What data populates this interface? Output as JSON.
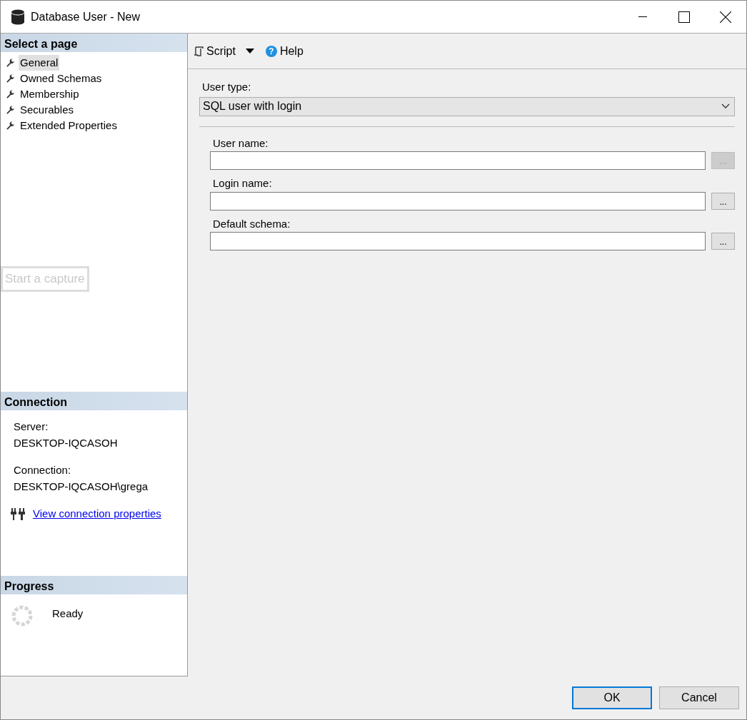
{
  "window": {
    "title": "Database User - New"
  },
  "select_page": {
    "title": "Select a page",
    "items": [
      {
        "label": "General",
        "selected": true
      },
      {
        "label": "Owned Schemas",
        "selected": false
      },
      {
        "label": "Membership",
        "selected": false
      },
      {
        "label": "Securables",
        "selected": false
      },
      {
        "label": "Extended Properties",
        "selected": false
      }
    ]
  },
  "capture_overlay": {
    "label": "Start a capture"
  },
  "connection": {
    "title": "Connection",
    "server_label": "Server:",
    "server": "DESKTOP-IQCASOH",
    "connection_label": "Connection:",
    "connection": "DESKTOP-IQCASOH\\grega",
    "link": "View connection properties"
  },
  "progress": {
    "title": "Progress",
    "status": "Ready"
  },
  "toolbar": {
    "script": "Script",
    "help_glyph": "?",
    "help": "Help"
  },
  "user_type": {
    "label": "User type:",
    "value": "SQL user with login"
  },
  "fields": [
    {
      "label": "User name:",
      "browse": "...",
      "disabled": true
    },
    {
      "label": "Login name:",
      "browse": "...",
      "disabled": false
    },
    {
      "label": "Default schema:",
      "browse": "...",
      "disabled": false
    }
  ],
  "buttons": [
    {
      "label": "OK",
      "default": true
    },
    {
      "label": "Cancel",
      "default": false
    }
  ]
}
